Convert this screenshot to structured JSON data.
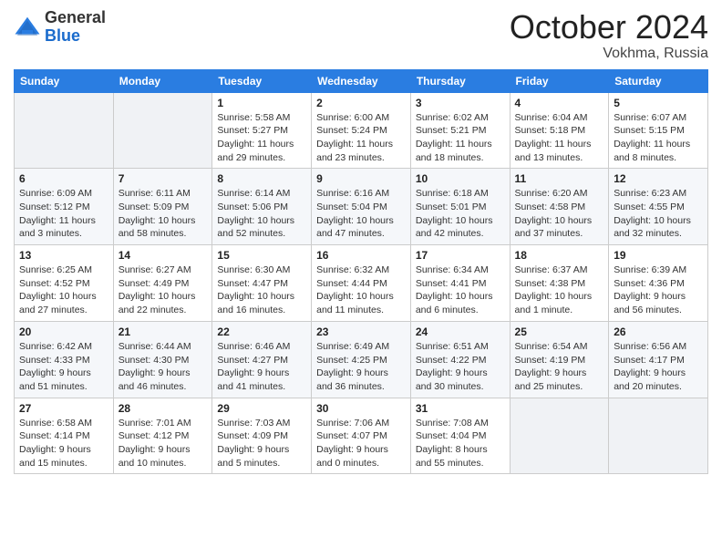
{
  "logo": {
    "general": "General",
    "blue": "Blue"
  },
  "title": "October 2024",
  "location": "Vokhma, Russia",
  "days_header": [
    "Sunday",
    "Monday",
    "Tuesday",
    "Wednesday",
    "Thursday",
    "Friday",
    "Saturday"
  ],
  "weeks": [
    [
      {
        "day": "",
        "info": ""
      },
      {
        "day": "",
        "info": ""
      },
      {
        "day": "1",
        "sunrise": "Sunrise: 5:58 AM",
        "sunset": "Sunset: 5:27 PM",
        "daylight": "Daylight: 11 hours and 29 minutes."
      },
      {
        "day": "2",
        "sunrise": "Sunrise: 6:00 AM",
        "sunset": "Sunset: 5:24 PM",
        "daylight": "Daylight: 11 hours and 23 minutes."
      },
      {
        "day": "3",
        "sunrise": "Sunrise: 6:02 AM",
        "sunset": "Sunset: 5:21 PM",
        "daylight": "Daylight: 11 hours and 18 minutes."
      },
      {
        "day": "4",
        "sunrise": "Sunrise: 6:04 AM",
        "sunset": "Sunset: 5:18 PM",
        "daylight": "Daylight: 11 hours and 13 minutes."
      },
      {
        "day": "5",
        "sunrise": "Sunrise: 6:07 AM",
        "sunset": "Sunset: 5:15 PM",
        "daylight": "Daylight: 11 hours and 8 minutes."
      }
    ],
    [
      {
        "day": "6",
        "sunrise": "Sunrise: 6:09 AM",
        "sunset": "Sunset: 5:12 PM",
        "daylight": "Daylight: 11 hours and 3 minutes."
      },
      {
        "day": "7",
        "sunrise": "Sunrise: 6:11 AM",
        "sunset": "Sunset: 5:09 PM",
        "daylight": "Daylight: 10 hours and 58 minutes."
      },
      {
        "day": "8",
        "sunrise": "Sunrise: 6:14 AM",
        "sunset": "Sunset: 5:06 PM",
        "daylight": "Daylight: 10 hours and 52 minutes."
      },
      {
        "day": "9",
        "sunrise": "Sunrise: 6:16 AM",
        "sunset": "Sunset: 5:04 PM",
        "daylight": "Daylight: 10 hours and 47 minutes."
      },
      {
        "day": "10",
        "sunrise": "Sunrise: 6:18 AM",
        "sunset": "Sunset: 5:01 PM",
        "daylight": "Daylight: 10 hours and 42 minutes."
      },
      {
        "day": "11",
        "sunrise": "Sunrise: 6:20 AM",
        "sunset": "Sunset: 4:58 PM",
        "daylight": "Daylight: 10 hours and 37 minutes."
      },
      {
        "day": "12",
        "sunrise": "Sunrise: 6:23 AM",
        "sunset": "Sunset: 4:55 PM",
        "daylight": "Daylight: 10 hours and 32 minutes."
      }
    ],
    [
      {
        "day": "13",
        "sunrise": "Sunrise: 6:25 AM",
        "sunset": "Sunset: 4:52 PM",
        "daylight": "Daylight: 10 hours and 27 minutes."
      },
      {
        "day": "14",
        "sunrise": "Sunrise: 6:27 AM",
        "sunset": "Sunset: 4:49 PM",
        "daylight": "Daylight: 10 hours and 22 minutes."
      },
      {
        "day": "15",
        "sunrise": "Sunrise: 6:30 AM",
        "sunset": "Sunset: 4:47 PM",
        "daylight": "Daylight: 10 hours and 16 minutes."
      },
      {
        "day": "16",
        "sunrise": "Sunrise: 6:32 AM",
        "sunset": "Sunset: 4:44 PM",
        "daylight": "Daylight: 10 hours and 11 minutes."
      },
      {
        "day": "17",
        "sunrise": "Sunrise: 6:34 AM",
        "sunset": "Sunset: 4:41 PM",
        "daylight": "Daylight: 10 hours and 6 minutes."
      },
      {
        "day": "18",
        "sunrise": "Sunrise: 6:37 AM",
        "sunset": "Sunset: 4:38 PM",
        "daylight": "Daylight: 10 hours and 1 minute."
      },
      {
        "day": "19",
        "sunrise": "Sunrise: 6:39 AM",
        "sunset": "Sunset: 4:36 PM",
        "daylight": "Daylight: 9 hours and 56 minutes."
      }
    ],
    [
      {
        "day": "20",
        "sunrise": "Sunrise: 6:42 AM",
        "sunset": "Sunset: 4:33 PM",
        "daylight": "Daylight: 9 hours and 51 minutes."
      },
      {
        "day": "21",
        "sunrise": "Sunrise: 6:44 AM",
        "sunset": "Sunset: 4:30 PM",
        "daylight": "Daylight: 9 hours and 46 minutes."
      },
      {
        "day": "22",
        "sunrise": "Sunrise: 6:46 AM",
        "sunset": "Sunset: 4:27 PM",
        "daylight": "Daylight: 9 hours and 41 minutes."
      },
      {
        "day": "23",
        "sunrise": "Sunrise: 6:49 AM",
        "sunset": "Sunset: 4:25 PM",
        "daylight": "Daylight: 9 hours and 36 minutes."
      },
      {
        "day": "24",
        "sunrise": "Sunrise: 6:51 AM",
        "sunset": "Sunset: 4:22 PM",
        "daylight": "Daylight: 9 hours and 30 minutes."
      },
      {
        "day": "25",
        "sunrise": "Sunrise: 6:54 AM",
        "sunset": "Sunset: 4:19 PM",
        "daylight": "Daylight: 9 hours and 25 minutes."
      },
      {
        "day": "26",
        "sunrise": "Sunrise: 6:56 AM",
        "sunset": "Sunset: 4:17 PM",
        "daylight": "Daylight: 9 hours and 20 minutes."
      }
    ],
    [
      {
        "day": "27",
        "sunrise": "Sunrise: 6:58 AM",
        "sunset": "Sunset: 4:14 PM",
        "daylight": "Daylight: 9 hours and 15 minutes."
      },
      {
        "day": "28",
        "sunrise": "Sunrise: 7:01 AM",
        "sunset": "Sunset: 4:12 PM",
        "daylight": "Daylight: 9 hours and 10 minutes."
      },
      {
        "day": "29",
        "sunrise": "Sunrise: 7:03 AM",
        "sunset": "Sunset: 4:09 PM",
        "daylight": "Daylight: 9 hours and 5 minutes."
      },
      {
        "day": "30",
        "sunrise": "Sunrise: 7:06 AM",
        "sunset": "Sunset: 4:07 PM",
        "daylight": "Daylight: 9 hours and 0 minutes."
      },
      {
        "day": "31",
        "sunrise": "Sunrise: 7:08 AM",
        "sunset": "Sunset: 4:04 PM",
        "daylight": "Daylight: 8 hours and 55 minutes."
      },
      {
        "day": "",
        "info": ""
      },
      {
        "day": "",
        "info": ""
      }
    ]
  ]
}
